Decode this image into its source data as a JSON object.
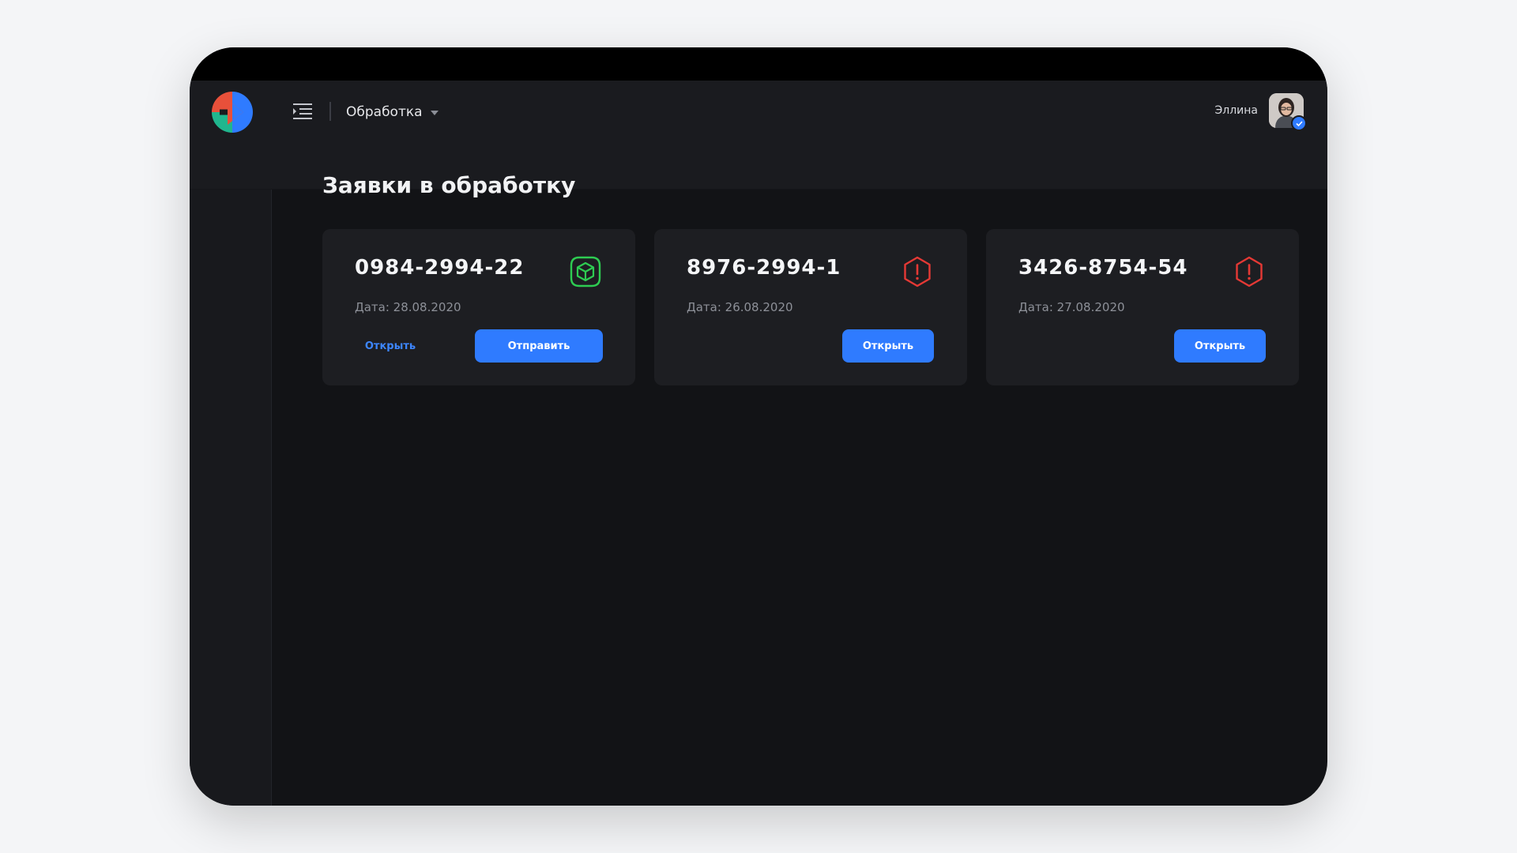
{
  "header": {
    "section_label": "Обработка",
    "user_name": "Эллина"
  },
  "main": {
    "title": "Заявки в обработку",
    "cards": [
      {
        "number": "0984-2994-22",
        "date": "Дата: 28.08.2020",
        "status_icon": "box-icon",
        "status_color": "#2ecc52",
        "open_label": "Открыть",
        "send_label": "Отправить"
      },
      {
        "number": "8976-2994-1",
        "date": "Дата: 26.08.2020",
        "status_icon": "warning-hexagon-icon",
        "status_color": "#e53935",
        "open_label": "Открыть"
      },
      {
        "number": "3426-8754-54",
        "date": "Дата: 27.08.2020",
        "status_icon": "warning-hexagon-icon",
        "status_color": "#e53935",
        "open_label": "Открыть"
      }
    ]
  },
  "colors": {
    "accent": "#2f7bff",
    "success": "#2ecc52",
    "danger": "#e53935",
    "background": "#121316",
    "card": "#1d1e22"
  }
}
